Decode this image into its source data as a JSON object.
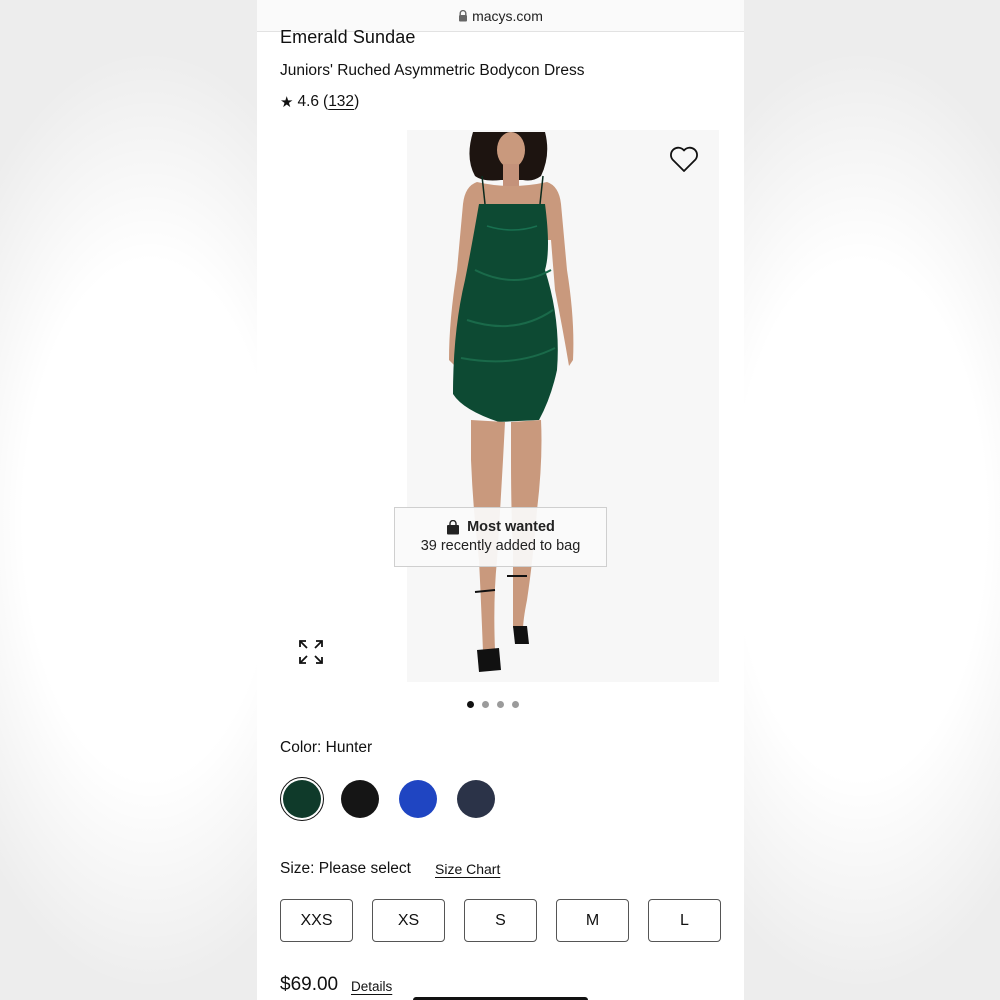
{
  "browser": {
    "url": "macys.com"
  },
  "product": {
    "brand": "Emerald Sundae",
    "title": "Juniors' Ruched Asymmetric Bodycon Dress",
    "rating": {
      "star": "★",
      "value": "4.6",
      "open_paren": "(",
      "count": "132",
      "close_paren": ")"
    }
  },
  "gallery": {
    "toast_title": "Most wanted",
    "toast_subtitle": "39 recently added to bag",
    "dots": [
      {
        "active": true
      },
      {
        "active": false
      },
      {
        "active": false
      },
      {
        "active": false
      }
    ]
  },
  "color": {
    "label": "Color: Hunter",
    "swatches": [
      {
        "name": "Hunter",
        "hex": "#0f3a2a",
        "selected": true
      },
      {
        "name": "Black",
        "hex": "#151515",
        "selected": false
      },
      {
        "name": "Royal",
        "hex": "#1f45c2",
        "selected": false
      },
      {
        "name": "Navy",
        "hex": "#2b3348",
        "selected": false
      }
    ]
  },
  "size": {
    "label": "Size: Please select",
    "chart_link": "Size Chart",
    "options": [
      "XXS",
      "XS",
      "S",
      "M",
      "L"
    ]
  },
  "price": {
    "value": "$69.00",
    "details_link": "Details"
  },
  "colors": {
    "dress": "#0d4a33",
    "skin": "#c9997d",
    "hair": "#1d1410"
  }
}
